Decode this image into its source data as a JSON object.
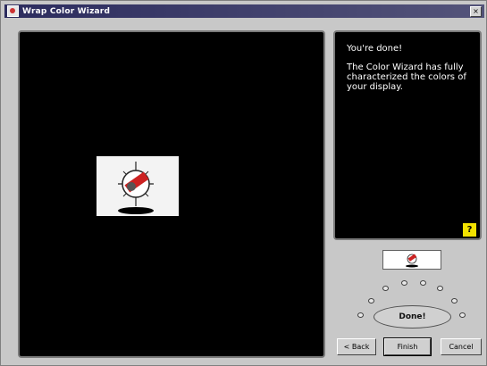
{
  "window": {
    "title": "Wrap Color Wizard",
    "close_glyph": "×"
  },
  "info": {
    "heading": "You're done!",
    "message": "The Color Wizard has fully characterized the colors of your display."
  },
  "help": {
    "label": "?"
  },
  "progress": {
    "done_label": "Done!",
    "steps_total": 8,
    "steps_completed": 8
  },
  "buttons": {
    "back": "< Back",
    "finish": "Finish",
    "cancel": "Cancel"
  },
  "colors": {
    "titlebar": "#2c2c5e",
    "panel_bg": "#000000",
    "help_accent": "#f3e200",
    "logo_red": "#cc2222"
  }
}
